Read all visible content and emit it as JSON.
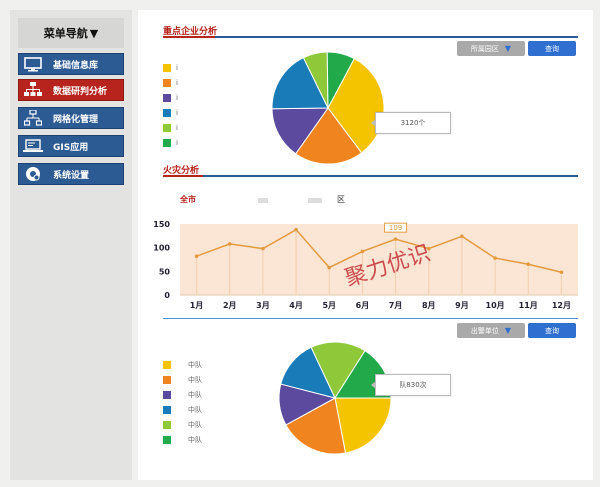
{
  "sidebar": {
    "header": "菜单导航",
    "header_arrow": "▼",
    "items": [
      {
        "label": "基础信息库",
        "icon": "monitor-icon"
      },
      {
        "label": "数据研判分析",
        "icon": "org-chart-icon",
        "active": true
      },
      {
        "label": "网格化管理",
        "icon": "grid-network-icon"
      },
      {
        "label": "GIS应用",
        "icon": "laptop-icon"
      },
      {
        "label": "系统设置",
        "icon": "gear-globe-icon"
      }
    ]
  },
  "enterprise": {
    "title": "重点企业分析",
    "filter_button": "所属园区",
    "query_button": "查询",
    "legend": [
      {
        "label": "i",
        "color": "#f5c400"
      },
      {
        "label": "i",
        "color": "#f0851f"
      },
      {
        "label": "i",
        "color": "#5b4a9e"
      },
      {
        "label": "i",
        "color": "#1a7bb9"
      },
      {
        "label": "i",
        "color": "#8fc93a"
      },
      {
        "label": "i",
        "color": "#22a94a"
      }
    ],
    "tooltip": "3120个",
    "chart_data": {
      "type": "pie",
      "values": [
        32,
        20,
        15,
        18,
        7,
        8
      ],
      "colors": [
        "#f5c400",
        "#f0851f",
        "#5b4a9e",
        "#1a7bb9",
        "#8fc93a",
        "#22a94a"
      ]
    }
  },
  "fire": {
    "title": "火灾分析",
    "scope_label": "全市",
    "district_label": "区",
    "data_label": "109",
    "watermark": "聚力优识",
    "chart_data": {
      "type": "area",
      "categories": [
        "1月",
        "2月",
        "3月",
        "4月",
        "5月",
        "6月",
        "7月",
        "8月",
        "9月",
        "10月",
        "11月",
        "12月"
      ],
      "values": [
        82,
        108,
        98,
        138,
        58,
        92,
        118,
        98,
        124,
        78,
        65,
        48
      ],
      "ylim": [
        0,
        150
      ],
      "yticks": [
        0,
        50,
        100,
        150
      ],
      "line_color": "#e39b3f",
      "fill_color": "#fbe5d4"
    }
  },
  "brigade": {
    "filter_button": "出警单位",
    "query_button": "查询",
    "legend": [
      {
        "label": "中队",
        "color": "#f5c400"
      },
      {
        "label": "中队",
        "color": "#f0851f"
      },
      {
        "label": "中队",
        "color": "#5b4a9e"
      },
      {
        "label": "中队",
        "color": "#1a7bb9"
      },
      {
        "label": "中队",
        "color": "#8fc93a"
      },
      {
        "label": "中队",
        "color": "#22a94a"
      }
    ],
    "tooltip": "队830次",
    "chart_data": {
      "type": "pie",
      "values": [
        22,
        20,
        12,
        14,
        16,
        16
      ],
      "colors": [
        "#f5c400",
        "#f0851f",
        "#5b4a9e",
        "#1a7bb9",
        "#8fc93a",
        "#22a94a"
      ]
    }
  }
}
